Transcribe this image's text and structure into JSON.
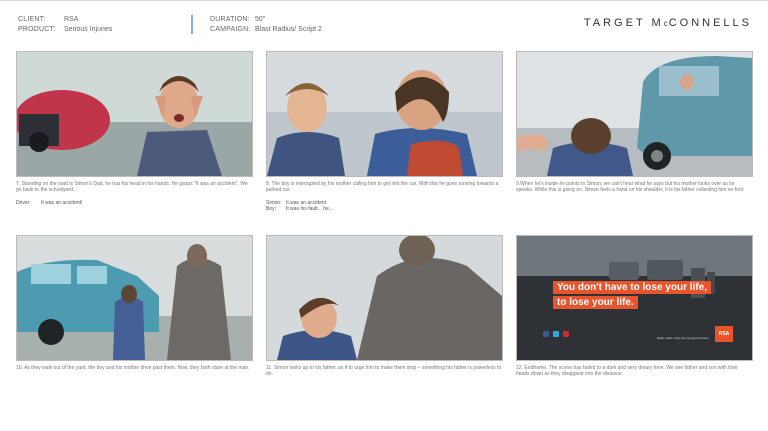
{
  "header": {
    "client_label": "CLIENT:",
    "client_value": "RSA",
    "product_label": "PRODUCT:",
    "product_value": "Serious Injuries",
    "duration_label": "DURATION:",
    "duration_value": "50\"",
    "campaign_label": "CAMPAIGN:",
    "campaign_value": "Blast Radius/ Script 2",
    "agency_logo": "TARGET McCONNELLS"
  },
  "frames": [
    {
      "caption": "7. Standing on the road is Simon's Dad, he has his head in his hands. He gasps \"It was an accident\". We go back to the schoolyard...",
      "dialogue": [
        {
          "who": "Driver:",
          "line": "It was an accident!"
        }
      ]
    },
    {
      "caption": "8. The boy is interrupted by his mother calling him to get into the car. With this he goes running towards a parked car.",
      "dialogue": [
        {
          "who": "Simon:",
          "line": "It was an accident"
        },
        {
          "who": "Boy:",
          "line": "It was his fault... he..."
        }
      ]
    },
    {
      "caption": "9.When he's inside he points to Simon, we can't hear what he says but his mother looks over as he speaks. While this is going on, Simon feels a hand on his shoulder, it is his father collecting him on foot.",
      "dialogue": []
    },
    {
      "caption": "10. As they walk out of the yard, the boy and his mother drive past them. Now, they both stare at the man.",
      "dialogue": []
    },
    {
      "caption": "11. Simon looks up to his father, as if to urge him to make them stop – something his father is powerless to do.",
      "dialogue": []
    },
    {
      "caption": "12. Endframe. The scene has faded to a dark and very dreary tone. We see father and son with their heads down as they disappear into the distance.",
      "dialogue": []
    }
  ],
  "endframe": {
    "line1": "You don't have to lose your life,",
    "line2": "to lose your life.",
    "badge": "RSA",
    "cta": "Safer roads. Only you can get us there"
  },
  "colors": {
    "accent_orange": "#e8542c",
    "divider_blue": "#7fb2d9"
  }
}
